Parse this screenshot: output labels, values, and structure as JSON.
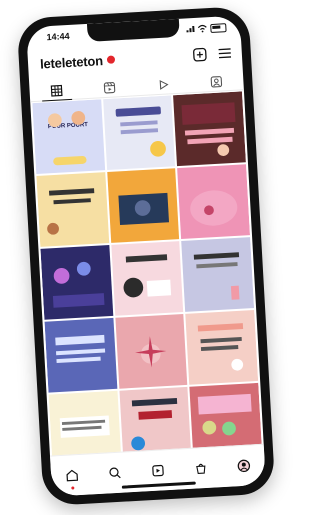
{
  "status_bar": {
    "time": "14:44"
  },
  "profile": {
    "username": "leteleteton"
  },
  "colors": {
    "accent": "#e3262c",
    "text": "#111111"
  },
  "tabs": [
    {
      "icon": "grid-icon",
      "active": true
    },
    {
      "icon": "reels-icon",
      "active": false
    },
    {
      "icon": "play-icon",
      "active": false
    },
    {
      "icon": "tagged-icon",
      "active": false
    }
  ],
  "posts": [
    {
      "bg": "#d7dcf6",
      "text": "POUR POURT"
    },
    {
      "bg": "#e7e9f5",
      "text": ""
    },
    {
      "bg": "#5b2a2a",
      "text": ""
    },
    {
      "bg": "#f6dfa3",
      "text": ""
    },
    {
      "bg": "#f2a73b",
      "text": ""
    },
    {
      "bg": "#ef94b6",
      "text": ""
    },
    {
      "bg": "#2d2a69",
      "text": ""
    },
    {
      "bg": "#f7d9df",
      "text": ""
    },
    {
      "bg": "#c6c7e3",
      "text": ""
    },
    {
      "bg": "#5a67b7",
      "text": ""
    },
    {
      "bg": "#eaa7ad",
      "text": ""
    },
    {
      "bg": "#f5cfc6",
      "text": ""
    },
    {
      "bg": "#f9f2d6",
      "text": ""
    },
    {
      "bg": "#f0c7c8",
      "text": ""
    },
    {
      "bg": "#d46c74",
      "text": ""
    }
  ],
  "bottom_nav": [
    {
      "icon": "home-icon",
      "active": true
    },
    {
      "icon": "search-icon",
      "active": false
    },
    {
      "icon": "reels-icon",
      "active": false
    },
    {
      "icon": "shop-icon",
      "active": false
    },
    {
      "icon": "profile-icon",
      "active": false
    }
  ]
}
